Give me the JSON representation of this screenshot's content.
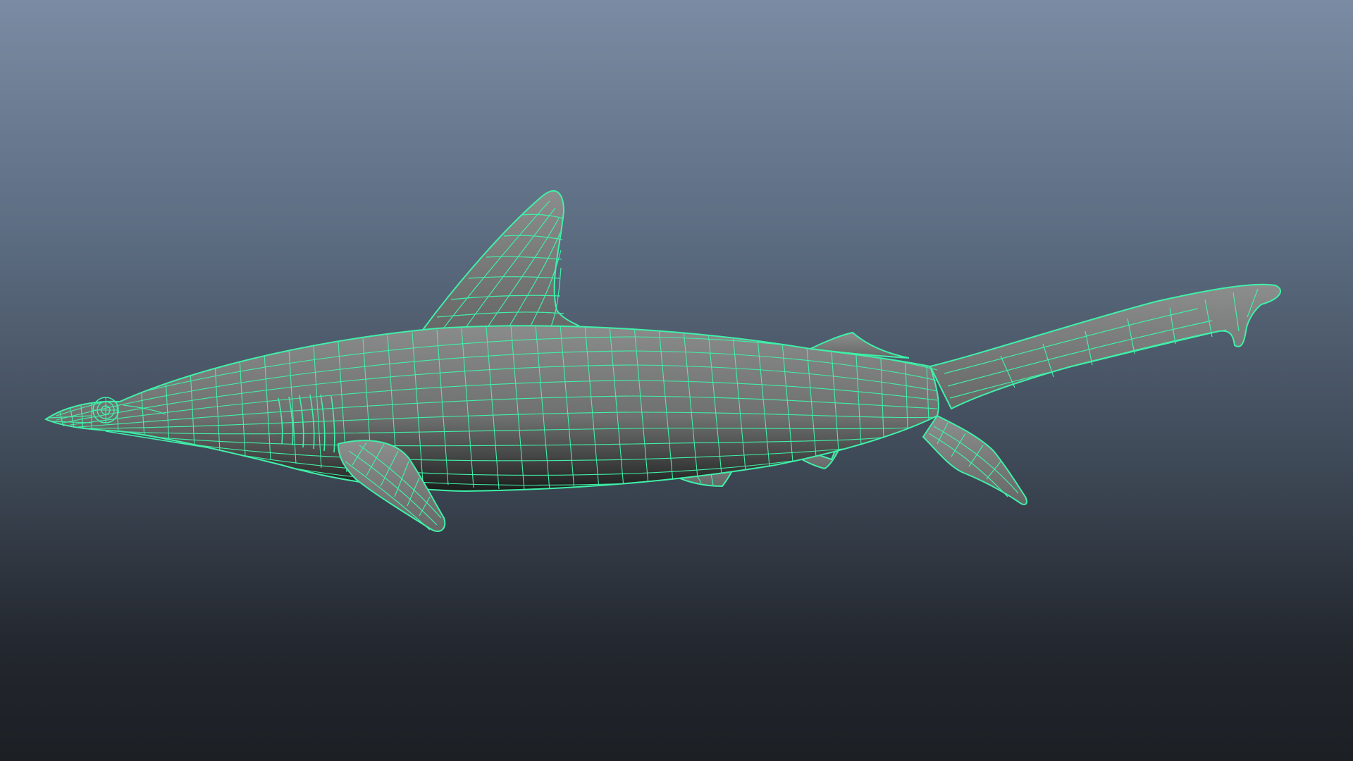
{
  "viewport": {
    "background_top": "#7a8ba3",
    "background_bottom": "#1c1f24"
  },
  "model": {
    "display_mode": "wireframe-on-shaded",
    "surface_color": "#6e6f6f",
    "wire_color": "#3ff0a8",
    "subject": "shark"
  }
}
